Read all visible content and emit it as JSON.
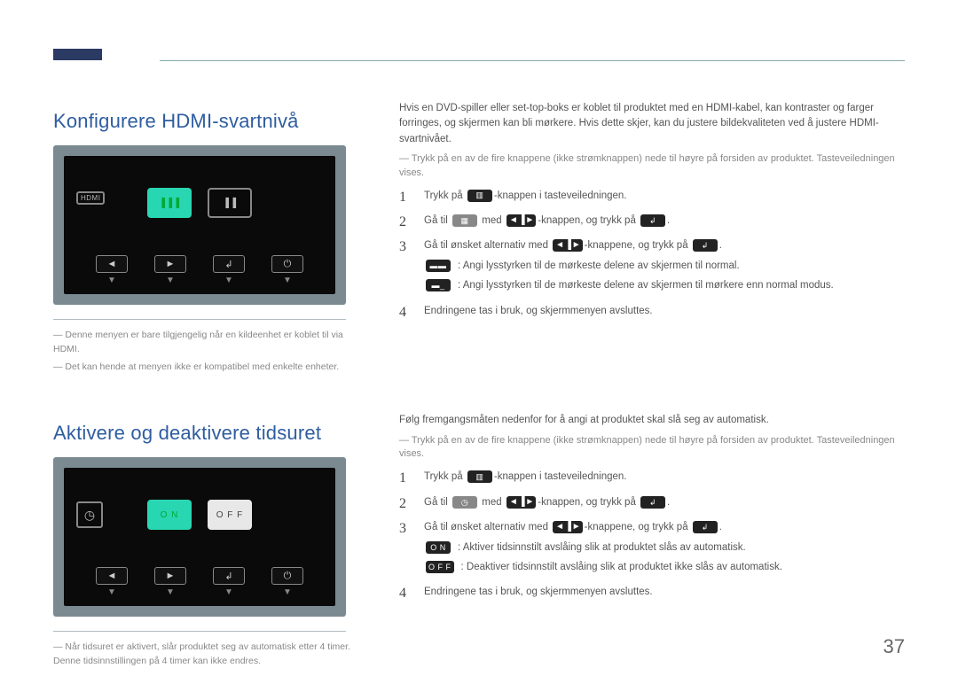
{
  "page_number": "37",
  "section1": {
    "title": "Konfigurere HDMI-svartnivå",
    "monitor": {
      "badge": "HDMI",
      "opt1_icon": "level-icon",
      "opt2_icon": "level-icon-alt"
    },
    "footnotes": [
      "Denne menyen er bare tilgjengelig når en kildeenhet er koblet til via HDMI.",
      "Det kan hende at menyen ikke er kompatibel med enkelte enheter."
    ],
    "intro": "Hvis en DVD-spiller eller set-top-boks er koblet til produktet med en HDMI-kabel, kan kontraster og farger forringes, og skjermen kan bli mørkere. Hvis dette skjer, kan du justere bildekvaliteten ved å justere HDMI-svartnivået.",
    "pre_note": "Trykk på en av de fire knappene (ikke strømknappen) nede til høyre på forsiden av produktet. Tasteveiledningen vises.",
    "steps": {
      "s1_a": "Trykk på ",
      "s1_b": "-knappen i tasteveiledningen.",
      "s2_a": "Gå til ",
      "s2_b": " med ",
      "s2_c": "-knappen, og trykk på ",
      "s2_d": ".",
      "s3_a": "Gå til ønsket alternativ med ",
      "s3_b": "-knappene, og trykk på ",
      "s3_c": ".",
      "s3_sub1": ": Angi lysstyrken til de mørkeste delene av skjermen til normal.",
      "s3_sub2": ": Angi lysstyrken til de mørkeste delene av skjermen til mørkere enn normal modus.",
      "s4": "Endringene tas i bruk, og skjermmenyen avsluttes."
    }
  },
  "section2": {
    "title": "Aktivere og deaktivere tidsuret",
    "monitor": {
      "opt_on": "O N",
      "opt_off": "O F F"
    },
    "footnotes": [
      "Når tidsuret er aktivert, slår produktet seg av automatisk etter 4 timer. Denne tidsinnstillingen på 4 timer kan ikke endres."
    ],
    "intro": "Følg fremgangsmåten nedenfor for å angi at produktet skal slå seg av automatisk.",
    "pre_note": "Trykk på en av de fire knappene (ikke strømknappen) nede til høyre på forsiden av produktet. Tasteveiledningen vises.",
    "steps": {
      "s1_a": "Trykk på ",
      "s1_b": "-knappen i tasteveiledningen.",
      "s2_a": "Gå til ",
      "s2_b": " med ",
      "s2_c": "-knappen, og trykk på ",
      "s2_d": ".",
      "s3_a": "Gå til ønsket alternativ med ",
      "s3_b": "-knappene, og trykk på ",
      "s3_c": ".",
      "s3_sub1_label": "O N",
      "s3_sub1": ": Aktiver tidsinnstilt avslåing slik at produktet slås av automatisk.",
      "s3_sub2_label": "O F F",
      "s3_sub2": ": Deaktiver tidsinnstilt avslåing slik at produktet ikke slås av automatisk.",
      "s4": "Endringene tas i bruk, og skjermmenyen avsluttes."
    }
  },
  "hw_buttons": {
    "left": "◄",
    "right": "►",
    "enter": "↲",
    "power": "⏻"
  },
  "icons": {
    "menu": "▥",
    "hdmi_target": "▦",
    "timer_target": "◷",
    "arrows_lr": "◄ ▐ ►",
    "enter": "↲",
    "level_norm": "▬▬",
    "level_low": "▬_"
  }
}
